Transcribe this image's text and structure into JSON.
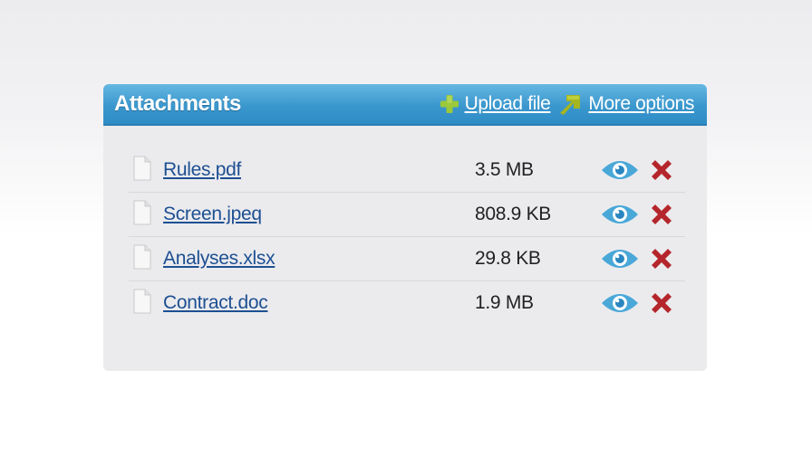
{
  "panel": {
    "title": "Attachments",
    "upload_label": "Upload file",
    "more_label": "More options"
  },
  "files": [
    {
      "name": "Rules.pdf",
      "size": "3.5 MB"
    },
    {
      "name": "Screen.jpeq",
      "size": "808.9 KB"
    },
    {
      "name": "Analyses.xlsx",
      "size": "29.8 KB"
    },
    {
      "name": "Contract.doc",
      "size": "1.9 MB"
    }
  ],
  "icons": {
    "add": "plus-icon",
    "more": "arrow-icon",
    "file": "file-icon",
    "view": "eye-icon",
    "delete": "delete-icon"
  },
  "colors": {
    "header": "#3a97cd",
    "link": "#1d4f92",
    "view_icon": "#4aa8d8",
    "delete_icon": "#b4262b",
    "add_icon": "#9bc93a"
  }
}
